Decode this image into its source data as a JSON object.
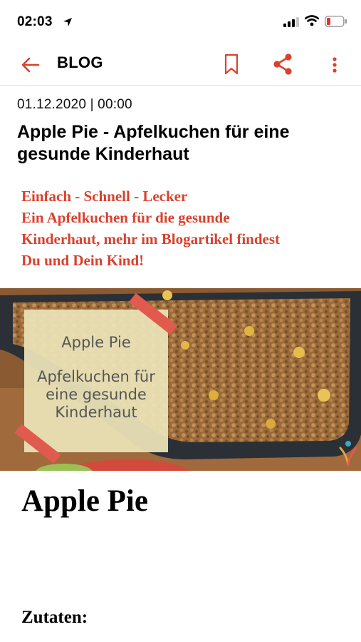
{
  "status_bar": {
    "time": "02:03",
    "icons": [
      "location-arrow-icon",
      "cellular-signal-icon",
      "wifi-icon",
      "battery-low-icon"
    ],
    "battery_color": "#e5322d"
  },
  "header": {
    "title": "BLOG",
    "accent_color": "#d9412e",
    "icons": [
      "back-arrow-icon",
      "bookmark-icon",
      "share-icon",
      "more-vertical-icon"
    ]
  },
  "article": {
    "date": "01.12.2020 | 00:00",
    "title": "Apple Pie - Apfelkuchen für eine gesunde Kinderhaut",
    "intro_lines": [
      "Einfach - Schnell - Lecker",
      "Ein Apfelkuchen für die gesunde",
      "Kinderhaut, mehr im Blogartikel findest",
      "Du und Dein Kind!"
    ],
    "intro_color": "#d9412e",
    "hero_image": {
      "overlay_title": "Apple Pie",
      "overlay_subtitle": "Apfelkuchen für eine gesunde Kinderhaut"
    },
    "heading": "Apple Pie",
    "subheading": "Zutaten:"
  }
}
